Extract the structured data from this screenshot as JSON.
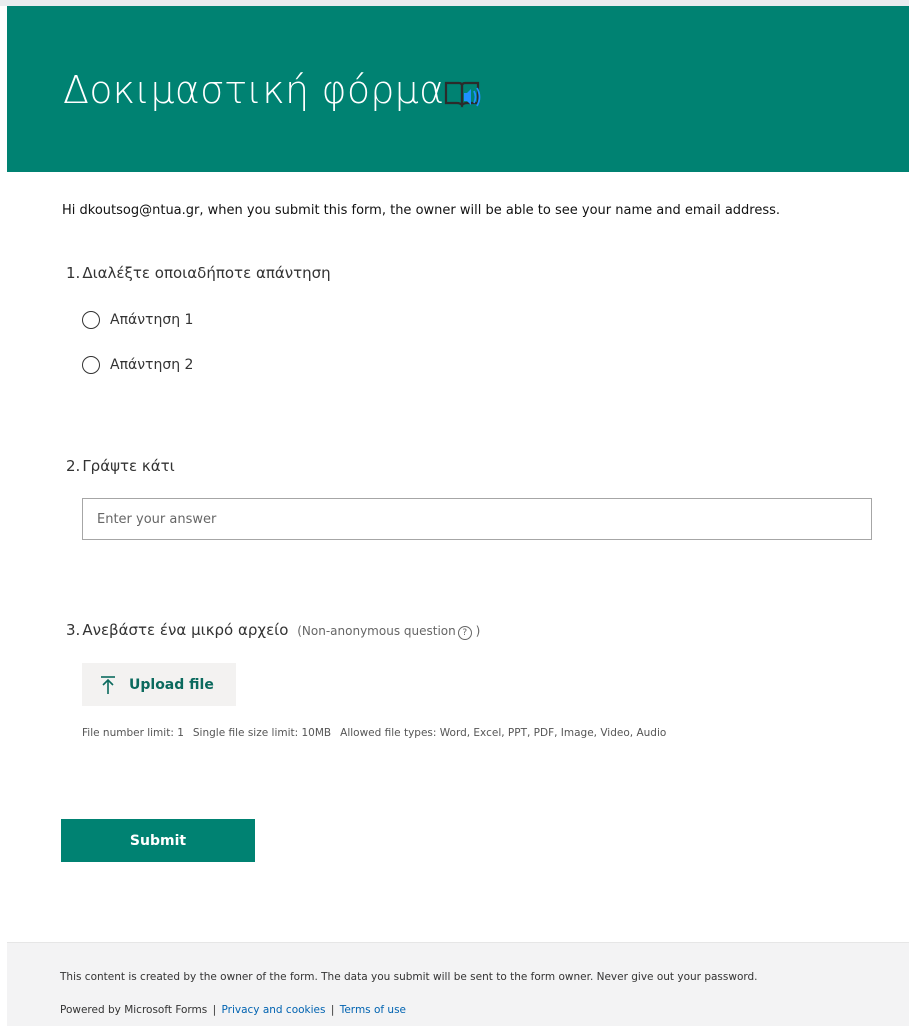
{
  "header": {
    "title": "Δοκιμαστική φόρμα",
    "icon": "immersive-reader-icon"
  },
  "intro": "Hi dkoutsog@ntua.gr, when you submit this form, the owner will be able to see your name and email address.",
  "questions": [
    {
      "number": "1.",
      "title": "Διαλέξτε οποιαδήποτε απάντηση",
      "type": "choice",
      "options": [
        "Απάντηση 1",
        "Απάντηση 2"
      ]
    },
    {
      "number": "2.",
      "title": "Γράψτε κάτι",
      "type": "text",
      "placeholder": "Enter your answer",
      "value": ""
    },
    {
      "number": "3.",
      "title": "Ανεβάστε ένα μικρό αρχείο",
      "note_open": "(Non-anonymous question",
      "help_glyph": "?",
      "note_close": ")",
      "type": "upload",
      "upload_label": "Upload file",
      "limits": {
        "count": "File number limit: 1",
        "size": "Single file size limit: 10MB",
        "types": "Allowed file types: Word, Excel, PPT, PDF, Image, Video, Audio"
      }
    }
  ],
  "submit_label": "Submit",
  "footer": {
    "note": "This content is created by the owner of the form. The data you submit will be sent to the form owner. Never give out your password.",
    "powered": "Powered by Microsoft Forms",
    "privacy": "Privacy and cookies",
    "terms": "Terms of use",
    "separator": "|"
  },
  "colors": {
    "brand": "#008272",
    "link": "#0063b1",
    "reader_icon_accent": "#1e90ff"
  }
}
